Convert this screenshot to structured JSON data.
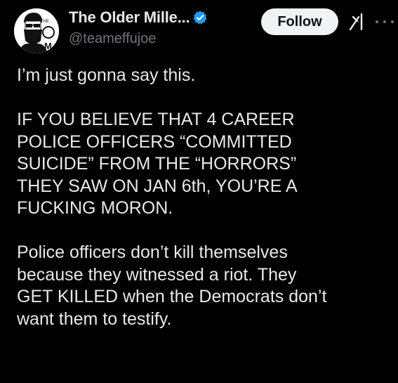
{
  "post": {
    "author": {
      "display_name": "The Older Mille...",
      "handle": "@teameffujoe",
      "verified": true,
      "avatar_icon": "avatar-logo-icon",
      "avatar_text_top": "THE",
      "avatar_letter_o": "O",
      "avatar_letter_m": "M"
    },
    "follow_label": "Follow",
    "paragraphs": [
      "I’m just gonna say this.",
      "IF YOU BELIEVE THAT 4 CAREER\nPOLICE OFFICERS “COMMITTED\nSUICIDE” FROM THE “HORRORS”\nTHEY SAW ON JAN 6th, YOU’RE A\nFUCKING MORON.",
      "Police officers don’t kill themselves\nbecause they witnessed a riot. They\nGET KILLED when the Democrats don’t\nwant them to testify."
    ]
  },
  "colors": {
    "background": "#000000",
    "text": "#e7e9ea",
    "secondary": "#71767b",
    "verified": "#1d9bf0",
    "follow_bg": "#eff3f4"
  },
  "icons": [
    "verified-badge-icon",
    "grok-icon",
    "more-options-icon"
  ]
}
